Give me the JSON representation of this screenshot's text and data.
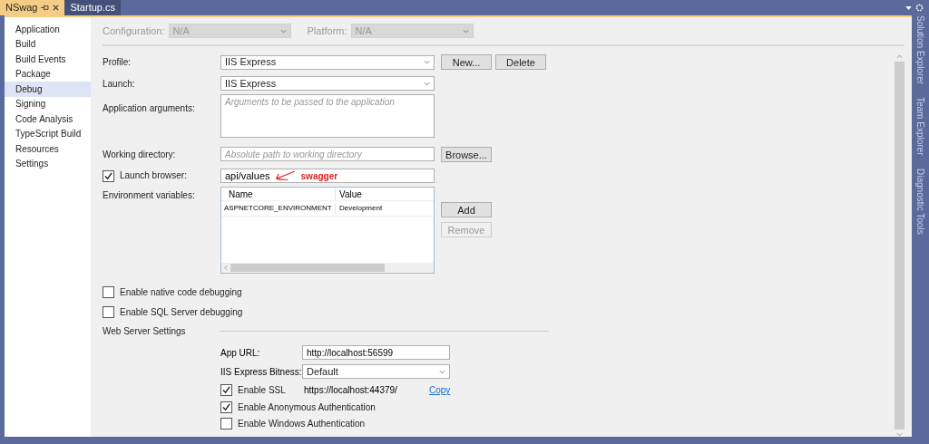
{
  "tabs": [
    {
      "label": "NSwag",
      "selected": true
    },
    {
      "label": "Startup.cs",
      "selected": false
    }
  ],
  "sidebar": {
    "items": [
      {
        "label": "Application",
        "selected": false
      },
      {
        "label": "Build",
        "selected": false
      },
      {
        "label": "Build Events",
        "selected": false
      },
      {
        "label": "Package",
        "selected": false
      },
      {
        "label": "Debug",
        "selected": true
      },
      {
        "label": "Signing",
        "selected": false
      },
      {
        "label": "Code Analysis",
        "selected": false
      },
      {
        "label": "TypeScript Build",
        "selected": false
      },
      {
        "label": "Resources",
        "selected": false
      },
      {
        "label": "Settings",
        "selected": false
      }
    ]
  },
  "config_bar": [
    {
      "label": "Configuration:",
      "value": "N/A",
      "disabled": true
    },
    {
      "label": "Platform:",
      "value": "N/A",
      "disabled": true
    }
  ],
  "profile": {
    "label": "Profile:",
    "value": "IIS Express",
    "buttons": [
      {
        "label": "New...",
        "disabled": false
      },
      {
        "label": "Delete",
        "disabled": false
      }
    ]
  },
  "launch": {
    "label": "Launch:",
    "value": "IIS Express"
  },
  "app_arguments": {
    "label": "Application arguments:",
    "placeholder": "Arguments to be passed to the application"
  },
  "working_directory": {
    "label": "Working directory:",
    "placeholder": "Absolute path to working directory",
    "button": "Browse..."
  },
  "launch_browser": {
    "label": "Launch browser:",
    "checked": true,
    "value": "api/values",
    "annotation": "swagger"
  },
  "environment_variables": {
    "label": "Environment variables:",
    "columns": [
      "Name",
      "Value"
    ],
    "rows": [
      [
        "ASPNETCORE_ENVIRONMENT",
        "Development"
      ]
    ],
    "buttons": [
      {
        "label": "Add",
        "disabled": false
      },
      {
        "label": "Remove",
        "disabled": true
      }
    ]
  },
  "debug_options": [
    {
      "label": "Enable native code debugging",
      "checked": false
    },
    {
      "label": "Enable SQL Server debugging",
      "checked": false
    }
  ],
  "web_server": {
    "title": "Web Server Settings",
    "app_url": {
      "label": "App URL:",
      "value": "http://localhost:56599"
    },
    "bitness": {
      "label": "IIS Express Bitness:",
      "value": "Default"
    },
    "ssl": {
      "label": "Enable SSL",
      "checked": true,
      "url": "https://localhost:44379/",
      "link": "Copy"
    },
    "options": [
      {
        "label": "Enable Anonymous Authentication",
        "checked": true
      },
      {
        "label": "Enable Windows Authentication",
        "checked": false
      }
    ]
  },
  "side_panels": [
    "Solution Explorer",
    "Team Explorer",
    "Diagnostic Tools"
  ]
}
